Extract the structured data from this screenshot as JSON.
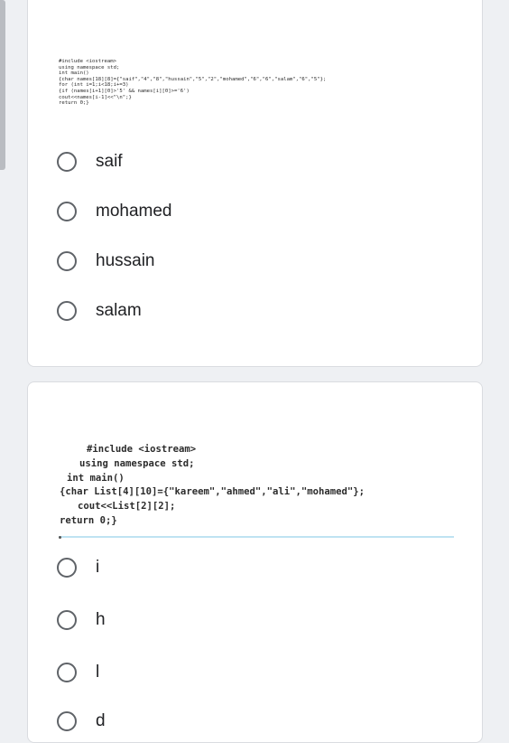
{
  "question1": {
    "code_lines": [
      "#include <iostream>",
      "using namespace std;",
      "int main()",
      "{char names[18][8]={\"saif\",\"4\",\"8\",\"hussain\",\"5\",\"2\",\"mohamed\",\"6\",\"6\",\"salam\",\"6\",\"5\"};",
      "for (int i=1;i<18;i+=3)",
      "{if (names[i+1][0]>'5' && names[i][0]>='6')",
      "cout<<names[i-1]<<\"\\n\";}",
      "return 0;}"
    ],
    "options": [
      "saif",
      "mohamed",
      "hussain",
      "salam"
    ]
  },
  "question2": {
    "code_lines": [
      "#include <iostream>",
      "using namespace std;",
      "int main()",
      "{char List[4][10]={\"kareem\",\"ahmed\",\"ali\",\"mohamed\"};",
      "cout<<List[2][2];",
      "return 0;}"
    ],
    "options": [
      "i",
      "h",
      "l",
      "d"
    ]
  },
  "colors": {
    "page_bg": "#eef0f3",
    "radio_border": "#5f6368",
    "code_string": "#c0392b",
    "divider": "#bfe3f2"
  }
}
